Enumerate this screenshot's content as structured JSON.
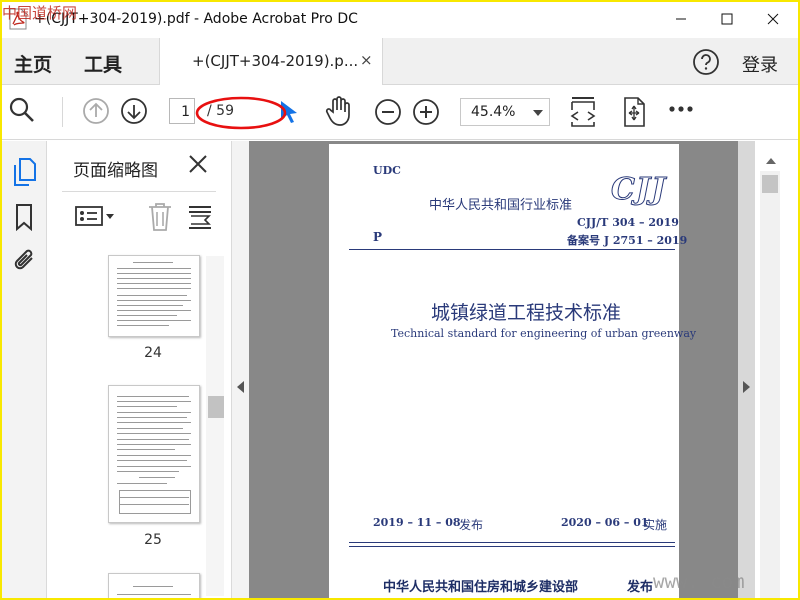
{
  "colors": {
    "accent": "#1473e6",
    "frame": "#f8e800",
    "annotation": "#e81010",
    "doc_bg": "#888888",
    "cover_text": "#2a3a7a"
  },
  "watermarks": {
    "top_left": "中国道桥网",
    "bottom_right": "www.            com"
  },
  "window": {
    "title": "+(CJJT+304-2019).pdf - Adobe Acrobat Pro DC",
    "app_icon": "acrobat-icon",
    "controls": [
      "minimize-icon",
      "maximize-icon",
      "close-icon"
    ]
  },
  "menu": {
    "home": "主页",
    "tools": "工具",
    "tab_label": "+(CJJT+304-2019).p...",
    "tab_close": "×",
    "login": "登录"
  },
  "toolbar": {
    "current_page": "1",
    "total_pages": "/ 59",
    "zoom": "45.4%",
    "icons": [
      "search-icon",
      "page-up-icon",
      "page-down-icon",
      "select-cursor-icon",
      "hand-icon",
      "zoom-out-icon",
      "zoom-in-icon",
      "fit-page-icon",
      "rotate-icon",
      "more-icon"
    ]
  },
  "left_nav": {
    "icons": [
      "pages-icon",
      "bookmark-icon",
      "attachment-icon"
    ]
  },
  "thumbnail_panel": {
    "title": "页面缩略图",
    "thumbnails": [
      {
        "label": "24"
      },
      {
        "label": "25"
      }
    ]
  },
  "document": {
    "udc": "UDC",
    "standard_type": "中华人民共和国行业标准",
    "logo": "CJJ",
    "code": "CJJ/T 304 – 2019",
    "p_label": "P",
    "record_no": "备案号 J 2751 – 2019",
    "title_cn": "城镇绿道工程技术标准",
    "title_en": "Technical standard for engineering of urban greenway",
    "issue_date": "2019 – 11 – 08",
    "issue_label": "发布",
    "impl_date": "2020 – 06 – 01",
    "impl_label": "实施",
    "ministry": "中华人民共和国住房和城乡建设部",
    "publish_label": "发布"
  }
}
